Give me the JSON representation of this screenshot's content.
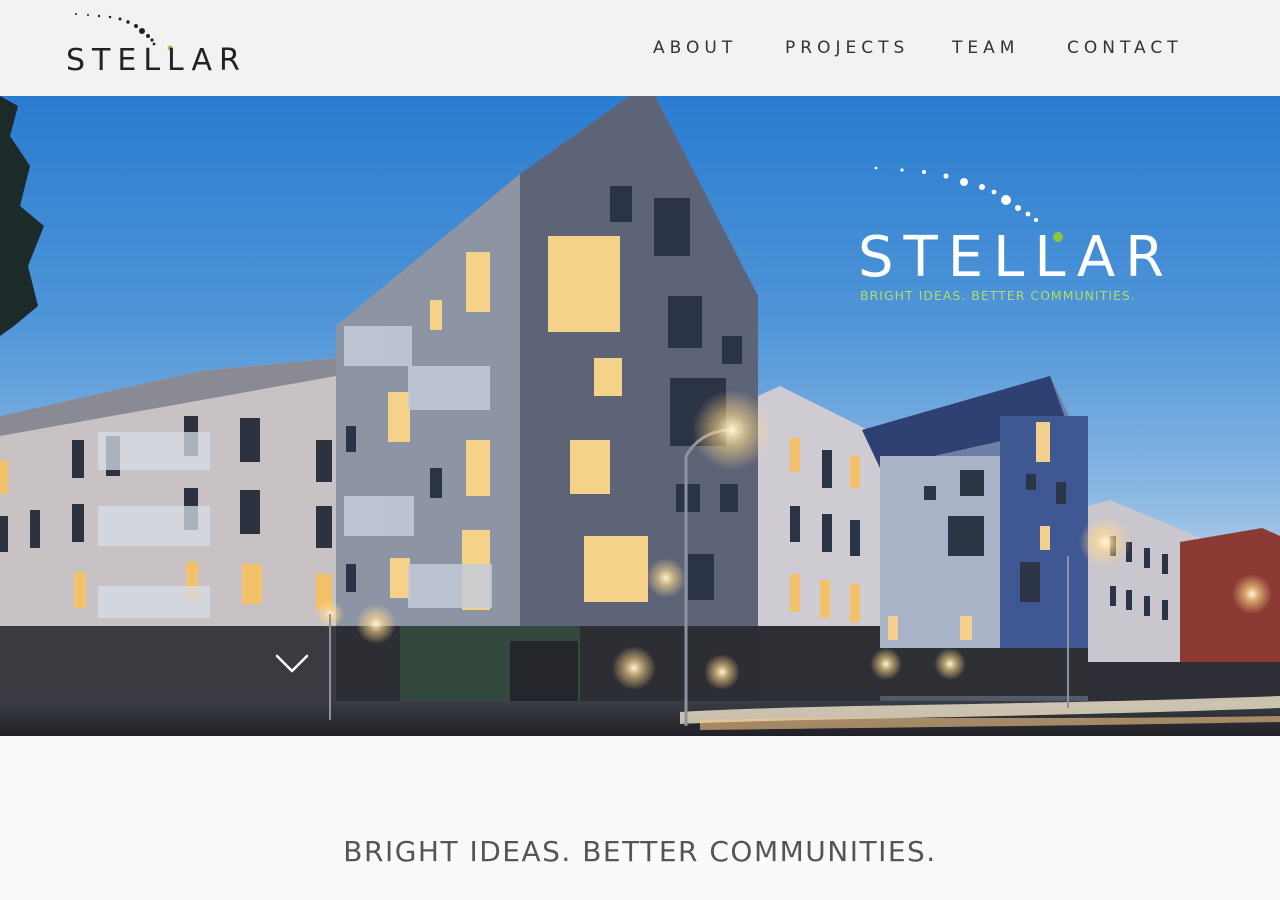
{
  "brand": {
    "name": "STELLAR",
    "tagline": "BRIGHT IDEAS. BETTER COMMUNITIES."
  },
  "nav": {
    "items": [
      {
        "label": "ABOUT"
      },
      {
        "label": "PROJECTS"
      },
      {
        "label": "TEAM"
      },
      {
        "label": "CONTACT"
      }
    ]
  },
  "hero": {
    "brand_name": "STELLAR",
    "brand_tagline": "BRIGHT IDEAS. BETTER COMMUNITIES.",
    "scroll_icon": "chevron-down-icon"
  },
  "main": {
    "tagline": "BRIGHT IDEAS. BETTER COMMUNITIES."
  },
  "colors": {
    "accent": "#8dc63f",
    "header_bg": "#f2f2f2",
    "text_dark": "#222222",
    "tagline_text": "#555555"
  }
}
